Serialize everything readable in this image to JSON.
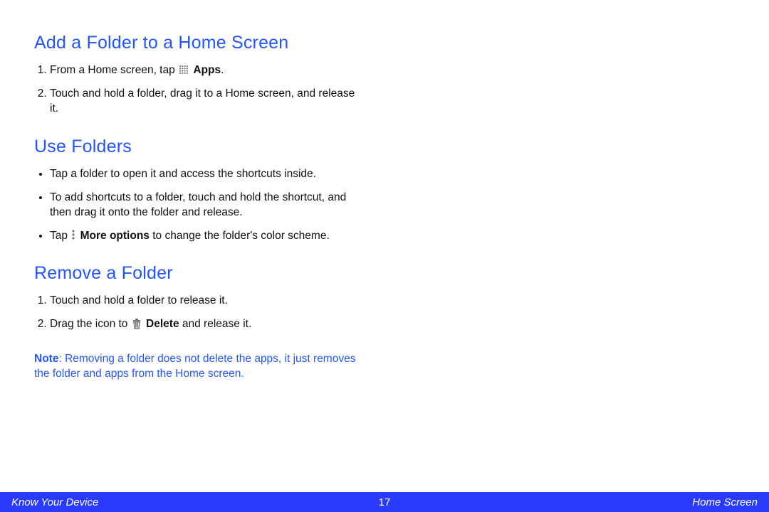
{
  "sections": [
    {
      "heading": "Add a Folder to a Home Screen",
      "items": [
        {
          "pre": "From a Home screen, tap ",
          "icon": "apps",
          "boldAfterIcon": "Apps",
          "post": "."
        },
        {
          "pre": "Touch and hold a folder, drag it to a Home screen, and release it."
        }
      ],
      "ordered": true
    },
    {
      "heading": "Use Folders",
      "items": [
        {
          "pre": "Tap a folder to open it and access the shortcuts inside."
        },
        {
          "pre": "To add shortcuts to a folder, touch and hold the shortcut, and then drag it onto the folder and release."
        },
        {
          "pre": "Tap ",
          "icon": "more",
          "boldAfterIcon": "More options",
          "post": " to change the folder's color scheme."
        }
      ],
      "ordered": false
    },
    {
      "heading": "Remove a Folder",
      "items": [
        {
          "pre": "Touch and hold a folder to release it."
        },
        {
          "pre": "Drag the icon to ",
          "icon": "trash",
          "boldAfterIcon": "Delete",
          "post": " and release it."
        }
      ],
      "ordered": true
    }
  ],
  "note": {
    "label": "Note",
    "text": ": Removing a folder does not delete the apps, it just removes the folder and apps from the Home screen."
  },
  "footer": {
    "left": "Know Your Device",
    "page": "17",
    "right": "Home Screen"
  }
}
